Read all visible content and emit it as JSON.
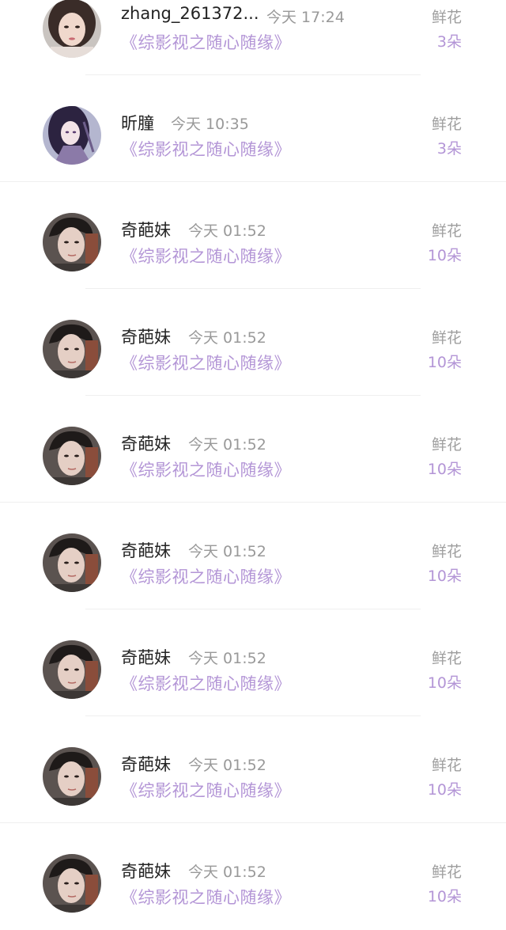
{
  "colors": {
    "title": "#b395d6",
    "count": "#b395d6",
    "name": "#222222",
    "meta": "#999999"
  },
  "rows": [
    {
      "name": "zhang_261372...",
      "time": "今天 17:24",
      "title": "《综影视之随心随缘》",
      "gift": "鲜花",
      "count": "3朵",
      "avatar": "avatar-girl"
    },
    {
      "name": "昕朣",
      "time": "今天 10:35",
      "title": "《综影视之随心随缘》",
      "gift": "鲜花",
      "count": "3朵",
      "avatar": "avatar-anime"
    },
    {
      "name": "奇葩妹",
      "time": "今天 01:52",
      "title": "《综影视之随心随缘》",
      "gift": "鲜花",
      "count": "10朵",
      "avatar": "avatar-man"
    },
    {
      "name": "奇葩妹",
      "time": "今天 01:52",
      "title": "《综影视之随心随缘》",
      "gift": "鲜花",
      "count": "10朵",
      "avatar": "avatar-man"
    },
    {
      "name": "奇葩妹",
      "time": "今天 01:52",
      "title": "《综影视之随心随缘》",
      "gift": "鲜花",
      "count": "10朵",
      "avatar": "avatar-man"
    },
    {
      "name": "奇葩妹",
      "time": "今天 01:52",
      "title": "《综影视之随心随缘》",
      "gift": "鲜花",
      "count": "10朵",
      "avatar": "avatar-man"
    },
    {
      "name": "奇葩妹",
      "time": "今天 01:52",
      "title": "《综影视之随心随缘》",
      "gift": "鲜花",
      "count": "10朵",
      "avatar": "avatar-man"
    },
    {
      "name": "奇葩妹",
      "time": "今天 01:52",
      "title": "《综影视之随心随缘》",
      "gift": "鲜花",
      "count": "10朵",
      "avatar": "avatar-man"
    },
    {
      "name": "奇葩妹",
      "time": "今天 01:52",
      "title": "《综影视之随心随缘》",
      "gift": "鲜花",
      "count": "10朵",
      "avatar": "avatar-man"
    }
  ]
}
